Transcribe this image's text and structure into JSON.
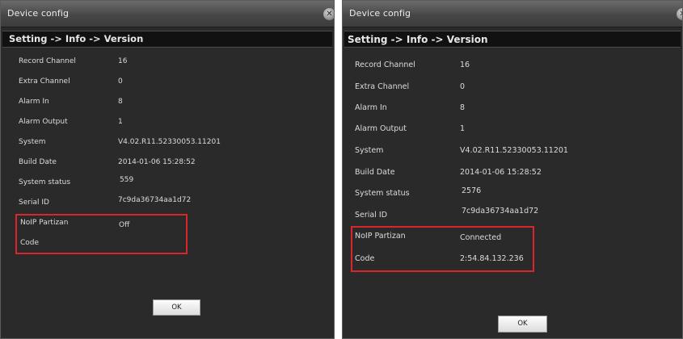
{
  "left": {
    "window_title": "Device config",
    "close_glyph": "✕",
    "breadcrumb": "Setting -> Info -> Version",
    "rows": [
      {
        "label": "Record Channel",
        "value": "16"
      },
      {
        "label": "Extra Channel",
        "value": "0"
      },
      {
        "label": "Alarm In",
        "value": "8"
      },
      {
        "label": "Alarm Output",
        "value": "1"
      },
      {
        "label": "System",
        "value": "V4.02.R11.52330053.11201"
      },
      {
        "label": "Build Date",
        "value": "2014-01-06 15:28:52"
      },
      {
        "label": "System status",
        "value": "559"
      },
      {
        "label": "Serial ID",
        "value": "7c9da36734aa1d72"
      },
      {
        "label": "NoIP Partizan",
        "value": "Off"
      },
      {
        "label": "Code",
        "value": ""
      }
    ],
    "ok_label": "OK"
  },
  "right": {
    "window_title": "Device config",
    "close_glyph": "✕",
    "breadcrumb": "Setting -> Info -> Version",
    "rows": [
      {
        "label": "Record Channel",
        "value": "16"
      },
      {
        "label": "Extra Channel",
        "value": "0"
      },
      {
        "label": "Alarm In",
        "value": "8"
      },
      {
        "label": "Alarm Output",
        "value": "1"
      },
      {
        "label": "System",
        "value": "V4.02.R11.52330053.11201"
      },
      {
        "label": "Build Date",
        "value": "2014-01-06 15:28:52"
      },
      {
        "label": "System status",
        "value": "2576"
      },
      {
        "label": "Serial ID",
        "value": "7c9da36734aa1d72"
      },
      {
        "label": "NoIP Partizan",
        "value": "Connected"
      },
      {
        "label": "Code",
        "value": "2:54.84.132.236"
      }
    ],
    "ok_label": "OK"
  },
  "colors": {
    "dialog_bg": "#2a2a2a",
    "breadcrumb_bg": "#111111",
    "text": "#dcdcdc",
    "highlight": "#d8262b"
  }
}
